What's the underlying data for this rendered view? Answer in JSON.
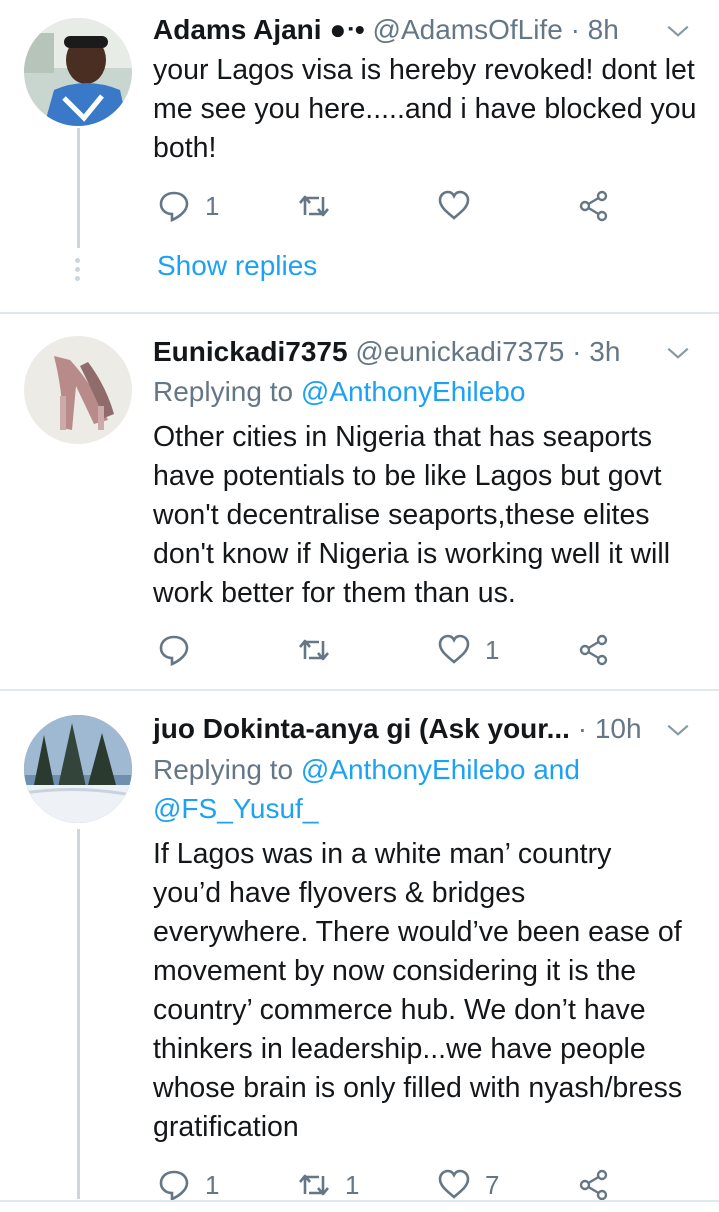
{
  "tweets": [
    {
      "name": "Adams Ajani",
      "name_suffix": "●ᐧ•",
      "handle": "@AdamsOfLife",
      "time": "· 8h",
      "body": "your Lagos visa is hereby revoked! dont let me see you here.....and i have blocked you both!",
      "reply_count": "1",
      "retweet_count": "",
      "like_count": "",
      "show_replies": "Show replies"
    },
    {
      "name": "Eunickadi7375",
      "handle": "@eunickadi7375",
      "time": "· 3h",
      "replying_prefix": "Replying to",
      "replying_to": "@AnthonyEhilebo",
      "body": "Other cities in Nigeria that has seaports have potentials to be like Lagos but govt won't decentralise seaports,these elites don't know if Nigeria is working well it will work better for them than us.",
      "reply_count": "",
      "retweet_count": "",
      "like_count": "1"
    },
    {
      "name": "juo Dokinta-anya gi (Ask your...",
      "handle": "",
      "time": "· 10h",
      "replying_prefix": "Replying to",
      "replying_to": "@AnthonyEhilebo",
      "replying_and": "and",
      "replying_to_2": "@FS_Yusuf_",
      "body": "If Lagos was in a white man’ country you’d have flyovers & bridges everywhere. There would’ve been ease of movement by now considering it is the country’ commerce hub. We don’t have thinkers in leadership...we have people whose brain is only filled with nyash/bress gratification",
      "reply_count": "1",
      "retweet_count": "1",
      "like_count": "7"
    }
  ],
  "icons": {
    "reply": "reply-icon",
    "retweet": "retweet-icon",
    "like": "heart-icon",
    "share": "share-icon",
    "more": "chevron-down-icon"
  },
  "colors": {
    "link": "#1da1f2",
    "muted": "#657786",
    "text": "#14171a",
    "divider": "#e1e8ed"
  }
}
